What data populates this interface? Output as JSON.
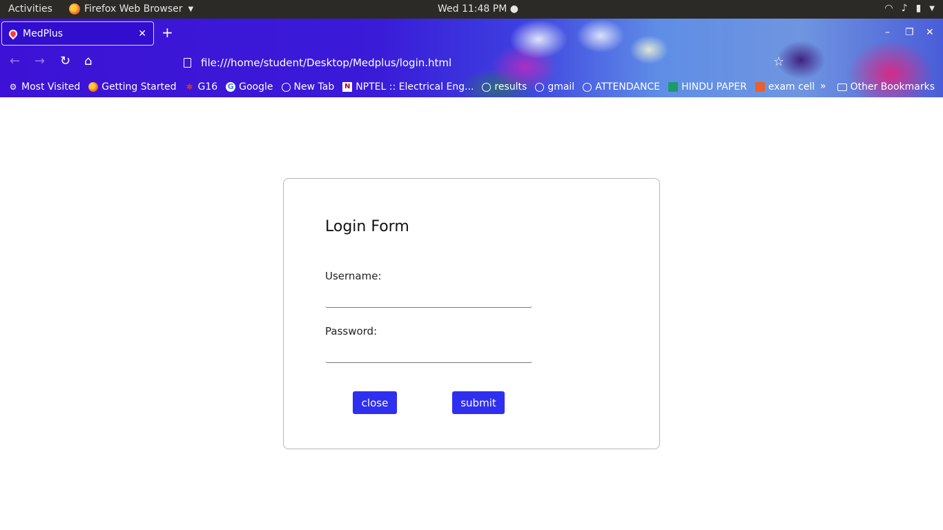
{
  "topbar": {
    "activities": "Activities",
    "app_name": "Firefox Web Browser",
    "clock": "Wed 11:48 PM"
  },
  "browser": {
    "tab_title": "MedPlus",
    "url": "file:///home/student/Desktop/Medplus/login.html",
    "bookmarks": [
      {
        "label": "Most Visited",
        "icon": "gear-icon"
      },
      {
        "label": "Getting Started",
        "icon": "firefox-icon"
      },
      {
        "label": "G16",
        "icon": "bug-icon"
      },
      {
        "label": "Google",
        "icon": "google-icon"
      },
      {
        "label": "New Tab",
        "icon": "globe-icon"
      },
      {
        "label": "NPTEL :: Electrical Eng...",
        "icon": "nptel-icon"
      },
      {
        "label": "results",
        "icon": "globe-icon"
      },
      {
        "label": "gmail",
        "icon": "globe-icon"
      },
      {
        "label": "ATTENDANCE",
        "icon": "globe-icon"
      },
      {
        "label": "HINDU PAPER",
        "icon": "hindu-icon"
      },
      {
        "label": "exam cell",
        "icon": "exam-icon"
      }
    ],
    "other_bookmarks": "Other Bookmarks"
  },
  "login": {
    "title": "Login Form",
    "username_label": "Username:",
    "username_value": "",
    "password_label": "Password:",
    "password_value": "",
    "close_label": "close",
    "submit_label": "submit",
    "button_color": "#2f2ff0"
  }
}
